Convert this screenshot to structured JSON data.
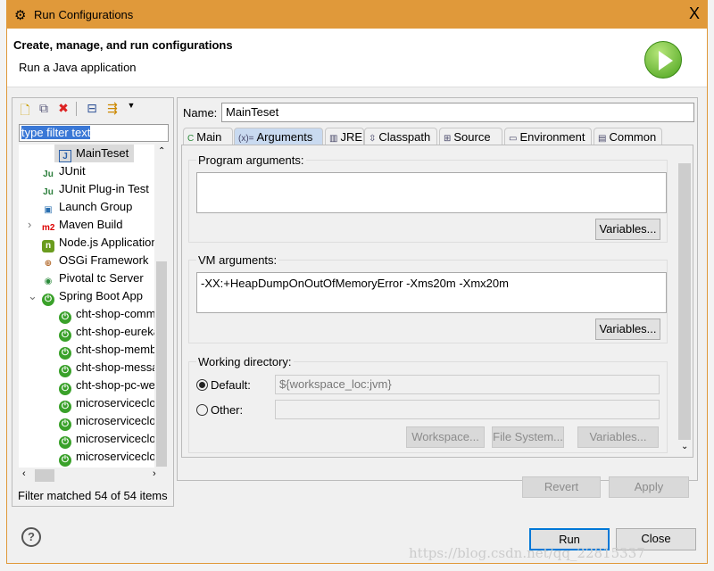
{
  "window": {
    "title": "Run Configurations",
    "close": "X",
    "accent": "#e0993a"
  },
  "header": {
    "title": "Create, manage, and run configurations",
    "subtitle": "Run a Java application",
    "icon": "run-icon"
  },
  "left": {
    "toolbar": [
      "new-config-icon",
      "duplicate-icon",
      "delete-icon",
      "collapse-all-icon",
      "filter-icon",
      "dropdown-icon"
    ],
    "filter": "type filter text",
    "tree": [
      {
        "label": "MainTeset",
        "level": 2,
        "icon": "J",
        "selected": true
      },
      {
        "label": "JUnit",
        "level": 1,
        "icon": "Ju"
      },
      {
        "label": "JUnit Plug-in Test",
        "level": 1,
        "icon": "Ju"
      },
      {
        "label": "Launch Group",
        "level": 1,
        "icon": "▣"
      },
      {
        "label": "Maven Build",
        "level": 1,
        "icon": "m2",
        "expander": "›"
      },
      {
        "label": "Node.js Application",
        "level": 1,
        "icon": "n"
      },
      {
        "label": "OSGi Framework",
        "level": 1,
        "icon": "⊕"
      },
      {
        "label": "Pivotal tc Server",
        "level": 1,
        "icon": "◉"
      },
      {
        "label": "Spring Boot App",
        "level": 1,
        "icon": "⏻",
        "expander": "⌄"
      },
      {
        "label": "cht-shop-commons",
        "level": 2,
        "icon": "⏻"
      },
      {
        "label": "cht-shop-eureka",
        "level": 2,
        "icon": "⏻"
      },
      {
        "label": "cht-shop-member",
        "level": 2,
        "icon": "⏻"
      },
      {
        "label": "cht-shop-message",
        "level": 2,
        "icon": "⏻"
      },
      {
        "label": "cht-shop-pc-web",
        "level": 2,
        "icon": "⏻"
      },
      {
        "label": "microserviceclo",
        "level": 2,
        "icon": "⏻"
      },
      {
        "label": "microserviceclo",
        "level": 2,
        "icon": "⏻"
      },
      {
        "label": "microserviceclo",
        "level": 2,
        "icon": "⏻"
      },
      {
        "label": "microserviceclo",
        "level": 2,
        "icon": "⏻"
      }
    ],
    "status": "Filter matched 54 of 54 items"
  },
  "right": {
    "name_label": "Name:",
    "name": "MainTeset",
    "tabs": [
      "Main",
      "Arguments",
      "JRE",
      "Classpath",
      "Source",
      "Environment",
      "Common"
    ],
    "tab_icons": [
      "C",
      "(x)=",
      "▥",
      "⇳",
      "⊞",
      "▭",
      "▤"
    ],
    "program_args_label": "Program arguments:",
    "program_args": "",
    "vm_args_label": "VM arguments:",
    "vm_args": "-XX:+HeapDumpOnOutOfMemoryError -Xms20m -Xmx20m",
    "variables": "Variables...",
    "workdir_label": "Working directory:",
    "default_label": "Default:",
    "default_value": "${workspace_loc:jvm}",
    "other_label": "Other:",
    "other_value": "",
    "workspace": "Workspace...",
    "filesystem": "File System...",
    "revert": "Revert",
    "apply": "Apply"
  },
  "footer": {
    "help": "?",
    "run": "Run",
    "close": "Close",
    "watermark": "https://blog.csdn.net/qq_22815337"
  }
}
